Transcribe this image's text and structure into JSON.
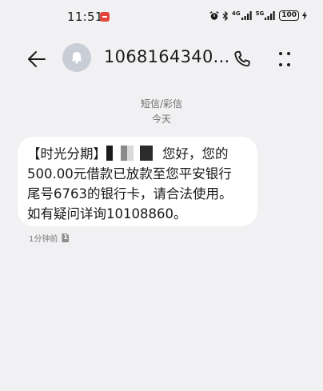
{
  "status_bar": {
    "time": "11:51",
    "network_1": "4G",
    "network_2": "5G",
    "battery": "100"
  },
  "header": {
    "title": "1068164340...",
    "back_icon": "arrow-left-icon",
    "avatar_icon": "bell-icon",
    "call_icon": "phone-icon",
    "more_icon": "more-vertical-icon"
  },
  "thread": {
    "channel": "短信/彩信",
    "date": "今天"
  },
  "message": {
    "line1_prefix": "【时光分期】",
    "line1_suffix": "您好，您的",
    "line2": "500.00元借款已放款至您平安银行",
    "line3": "尾号6763的银行卡，请合法使用。",
    "line4": "如有疑问详询10108860。",
    "time": "1分钟前",
    "sim": "1"
  }
}
